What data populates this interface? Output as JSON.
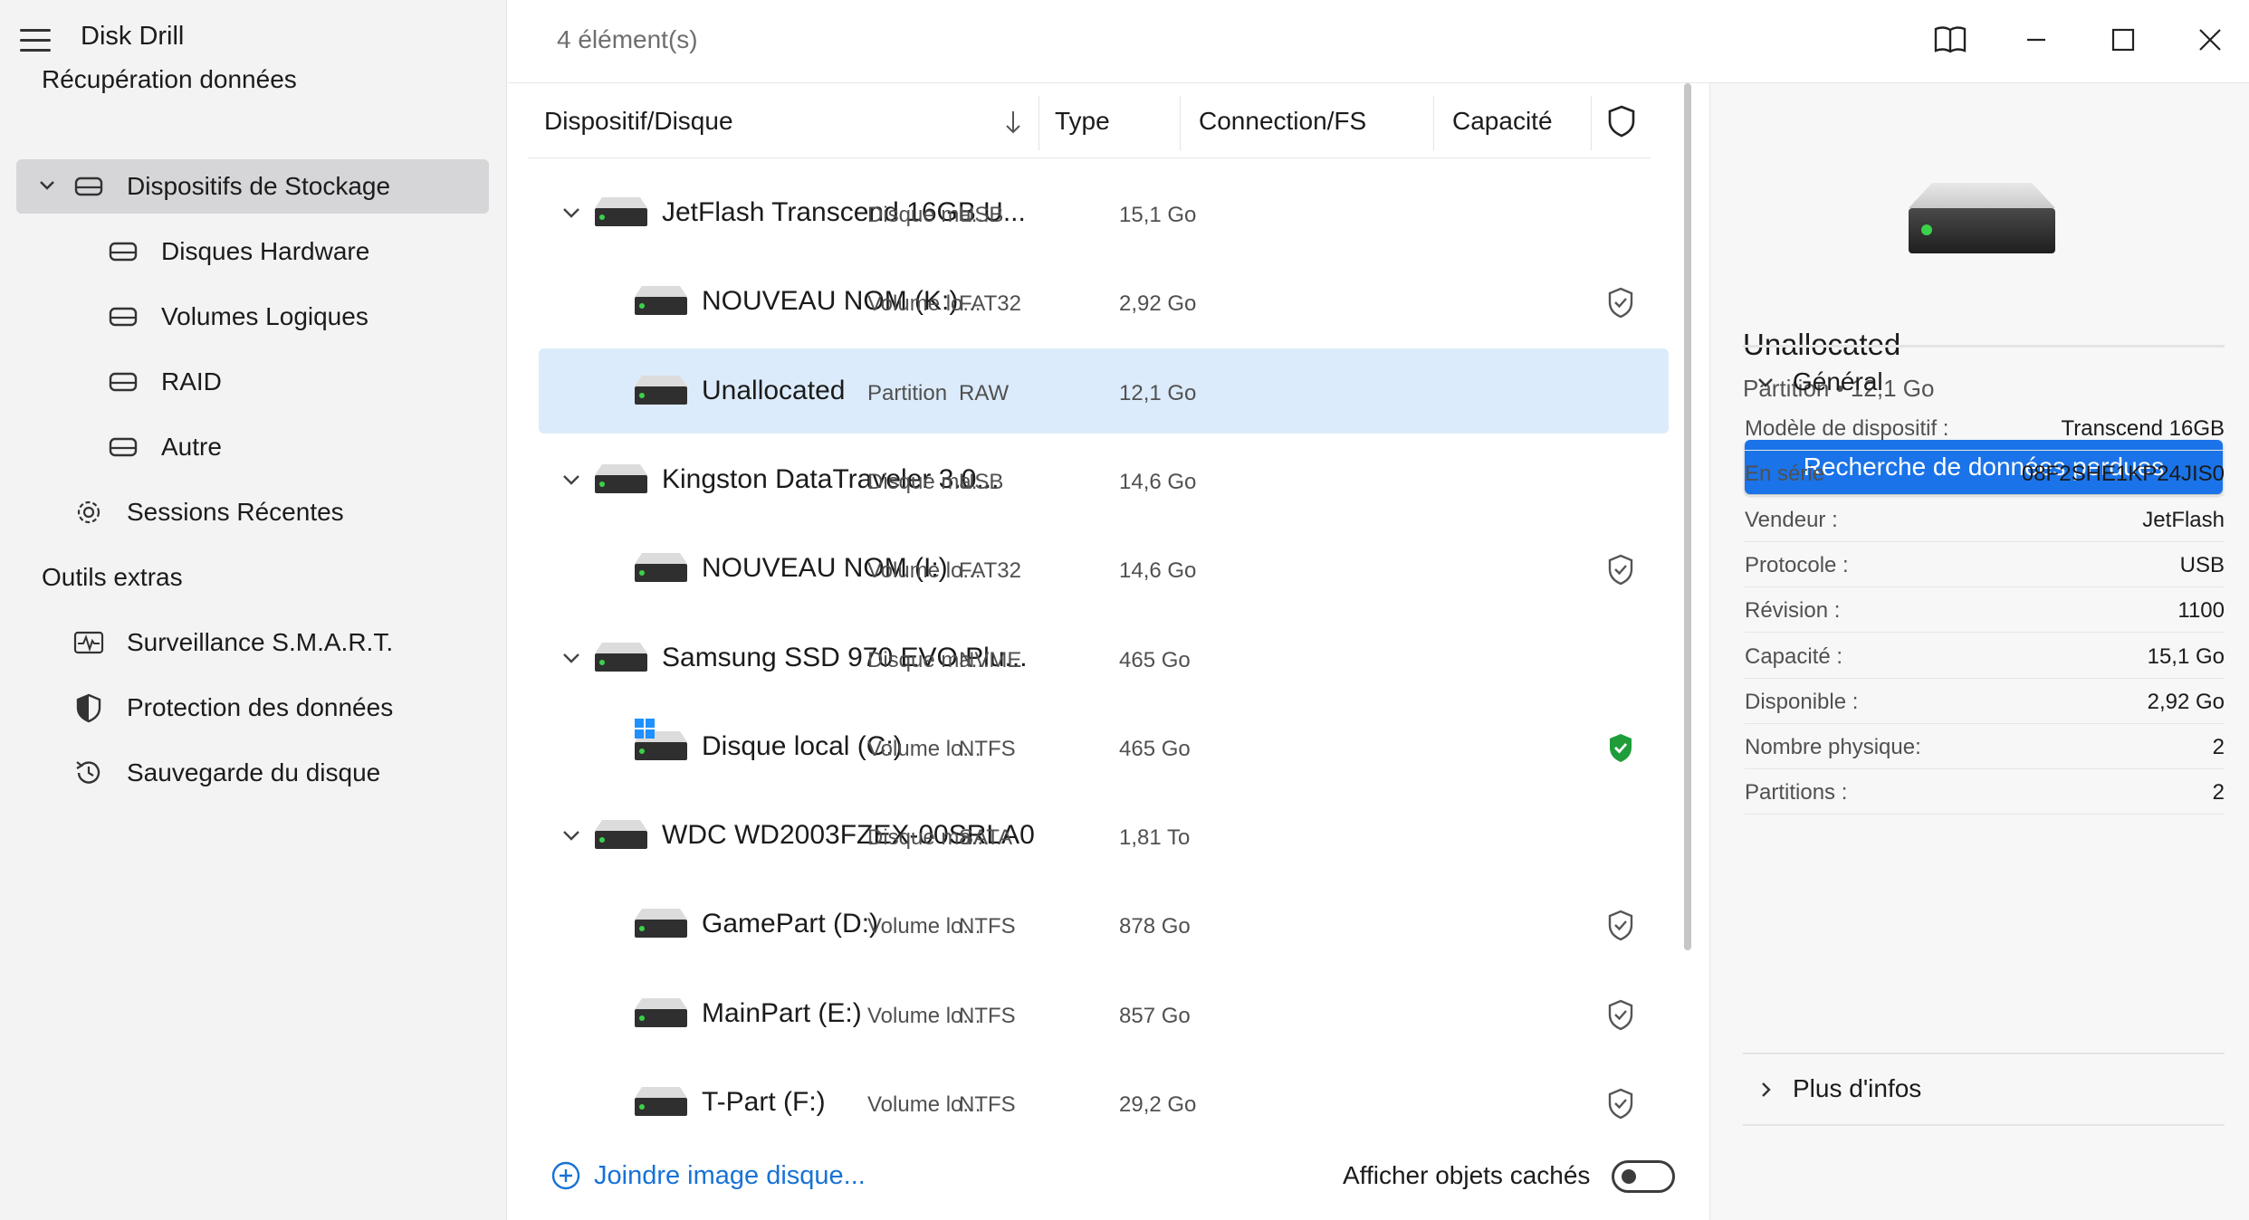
{
  "app": {
    "title": "Disk Drill"
  },
  "sidebar": {
    "section_recovery": "Récupération données",
    "storage": {
      "label": "Dispositifs de Stockage"
    },
    "sub_items": [
      {
        "label": "Disques Hardware"
      },
      {
        "label": "Volumes Logiques"
      },
      {
        "label": "RAID"
      },
      {
        "label": "Autre"
      }
    ],
    "recent": {
      "label": "Sessions Récentes"
    },
    "section_tools": "Outils extras",
    "tools": [
      {
        "label": "Surveillance S.M.A.R.T."
      },
      {
        "label": "Protection des données"
      },
      {
        "label": "Sauvegarde du disque"
      }
    ]
  },
  "header": {
    "item_count": "4 élément(s)"
  },
  "table": {
    "columns": {
      "device": "Dispositif/Disque",
      "type": "Type",
      "connection": "Connection/FS",
      "capacity": "Capacité"
    },
    "rows": [
      {
        "name": "JetFlash Transcend 16GB U...",
        "type": "Disque ma...",
        "fs": "USB",
        "capacity": "15,1 Go",
        "level": 0,
        "protection": "none"
      },
      {
        "name": "NOUVEAU NOM (K:)",
        "type": "Volume lo...",
        "fs": "FAT32",
        "capacity": "2,92 Go",
        "level": 1,
        "protection": "outline"
      },
      {
        "name": "Unallocated",
        "type": "Partition",
        "fs": "RAW",
        "capacity": "12,1 Go",
        "level": 1,
        "protection": "none",
        "selected": true
      },
      {
        "name": "Kingston DataTraveler 3.0...",
        "type": "Disque ma...",
        "fs": "USB",
        "capacity": "14,6 Go",
        "level": 0,
        "protection": "none"
      },
      {
        "name": "NOUVEAU NOM (I:)",
        "type": "Volume lo...",
        "fs": "FAT32",
        "capacity": "14,6 Go",
        "level": 1,
        "protection": "outline"
      },
      {
        "name": "Samsung SSD 970 EVO Plu...",
        "type": "Disque ma...",
        "fs": "NVME",
        "capacity": "465 Go",
        "level": 0,
        "protection": "none"
      },
      {
        "name": "Disque local (C:)",
        "type": "Volume lo...",
        "fs": "NTFS",
        "capacity": "465 Go",
        "level": 1,
        "protection": "protected",
        "windows": true
      },
      {
        "name": "WDC WD2003FZEX-00SRLA0",
        "type": "Disque ma...",
        "fs": "SATA",
        "capacity": "1,81 To",
        "level": 0,
        "protection": "none"
      },
      {
        "name": "GamePart (D:)",
        "type": "Volume lo...",
        "fs": "NTFS",
        "capacity": "878 Go",
        "level": 1,
        "protection": "outline"
      },
      {
        "name": "MainPart (E:)",
        "type": "Volume lo...",
        "fs": "NTFS",
        "capacity": "857 Go",
        "level": 1,
        "protection": "outline"
      },
      {
        "name": "T-Part (F:)",
        "type": "Volume lo...",
        "fs": "NTFS",
        "capacity": "29,2 Go",
        "level": 1,
        "protection": "outline"
      }
    ]
  },
  "footer": {
    "attach_label": "Joindre image disque...",
    "hidden_label": "Afficher objets cachés",
    "hidden_enabled": false
  },
  "panel": {
    "title": "Unallocated",
    "subtitle": "Partition • 12,1 Go",
    "scan_button": "Recherche de données perdues",
    "general_label": "Général",
    "details": [
      {
        "key": "Modèle de dispositif :",
        "value": "Transcend 16GB"
      },
      {
        "key": "En série",
        "value": "08F2SHE1KP24JIS0"
      },
      {
        "key": "Vendeur :",
        "value": "JetFlash"
      },
      {
        "key": "Protocole :",
        "value": "USB"
      },
      {
        "key": "Révision :",
        "value": "1100"
      },
      {
        "key": "Capacité :",
        "value": "15,1 Go"
      },
      {
        "key": "Disponible :",
        "value": "2,92 Go"
      },
      {
        "key": "Nombre physique:",
        "value": "2"
      },
      {
        "key": "Partitions :",
        "value": "2"
      }
    ],
    "more_label": "Plus d'infos"
  },
  "colors": {
    "accent": "#1a73e8",
    "selected_row": "#dcebfb",
    "protected_green": "#1f9d3a",
    "link": "#1772d5"
  }
}
